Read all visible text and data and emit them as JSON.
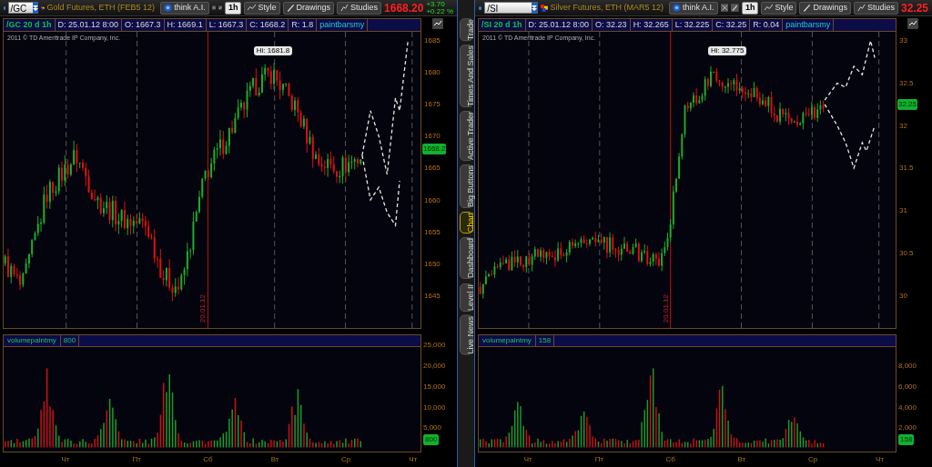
{
  "panels": [
    {
      "symbol": "/GC",
      "description": "Gold Futures, ETH (FEB5 12)",
      "think_button": "think A.I.",
      "interval": "1h",
      "style_button": "Style",
      "drawings_button": "Drawings",
      "studies_button": "Studies",
      "last_price": "1668.20",
      "change": "+3.70",
      "change_percent": "+0.22 %",
      "info": [
        {
          "kind": "symbol",
          "text": "/GC 20 d 1h"
        },
        {
          "kind": "field",
          "text": "D: 25.01.12 8:00"
        },
        {
          "kind": "field",
          "text": "O: 1667.3"
        },
        {
          "kind": "field",
          "text": "H: 1669.1"
        },
        {
          "kind": "field",
          "text": "L: 1667.3"
        },
        {
          "kind": "field",
          "text": "C: 1668.2"
        },
        {
          "kind": "field",
          "text": "R: 1.8"
        },
        {
          "kind": "study",
          "text": "paintbarsmy"
        }
      ],
      "copyright": "2011 © TD Ameritrade IP Company, Inc.",
      "high_label": "Hi: 1681.8",
      "date_marker": "20.01.12",
      "price_axis": [
        "1685",
        "1680",
        "1675",
        "1670",
        "1665",
        "1660",
        "1655",
        "1650",
        "1645"
      ],
      "current_price": "1668.2",
      "volume": {
        "study": "volumepaintmy",
        "value": "800",
        "axis": [
          "25,000",
          "20,000",
          "15,000",
          "10,000",
          "5,000"
        ],
        "current": "800"
      },
      "days": [
        "Чт",
        "Пт",
        "Сб",
        "Вт",
        "Ср",
        "Чт"
      ]
    },
    {
      "symbol": "/SI",
      "description": "Silver Futures, ETH (MAR5 12)",
      "think_button": "think A.I.",
      "interval": "1h",
      "style_button": "Style",
      "drawings_button": "Drawings",
      "studies_button": "Studies",
      "last_price": "32.25",
      "info": [
        {
          "kind": "symbol",
          "text": "/SI 20 d 1h"
        },
        {
          "kind": "field",
          "text": "D: 25.01.12 8:00"
        },
        {
          "kind": "field",
          "text": "O: 32.23"
        },
        {
          "kind": "field",
          "text": "H: 32.265"
        },
        {
          "kind": "field",
          "text": "L: 32.225"
        },
        {
          "kind": "field",
          "text": "C: 32.25"
        },
        {
          "kind": "field",
          "text": "R: 0.04"
        },
        {
          "kind": "study",
          "text": "paintbarsmy"
        }
      ],
      "copyright": "2011 © TD Ameritrade IP Company, Inc.",
      "high_label": "Hi: 32.775",
      "date_marker": "20.01.12",
      "price_axis": [
        "33",
        "32.5",
        "32",
        "31.5",
        "31",
        "30.5",
        "30"
      ],
      "current_price": "32.25",
      "volume": {
        "study": "volumepaintmy",
        "value": "158",
        "axis": [
          "8,000",
          "6,000",
          "4,000",
          "2,000"
        ],
        "current": "158"
      },
      "days": [
        "Чт",
        "Пт",
        "Сб",
        "Вт",
        "Ср",
        "Чт"
      ]
    }
  ],
  "sidebar_tabs": [
    {
      "label": "Trade",
      "selected": false
    },
    {
      "label": "Times And Sales",
      "selected": false
    },
    {
      "label": "Active Trader",
      "selected": false
    },
    {
      "label": "Big Buttons",
      "selected": false
    },
    {
      "label": "Chart",
      "selected": true
    },
    {
      "label": "Dashboard",
      "selected": false
    },
    {
      "label": "Level II",
      "selected": false
    },
    {
      "label": "Live News",
      "selected": false
    }
  ]
}
